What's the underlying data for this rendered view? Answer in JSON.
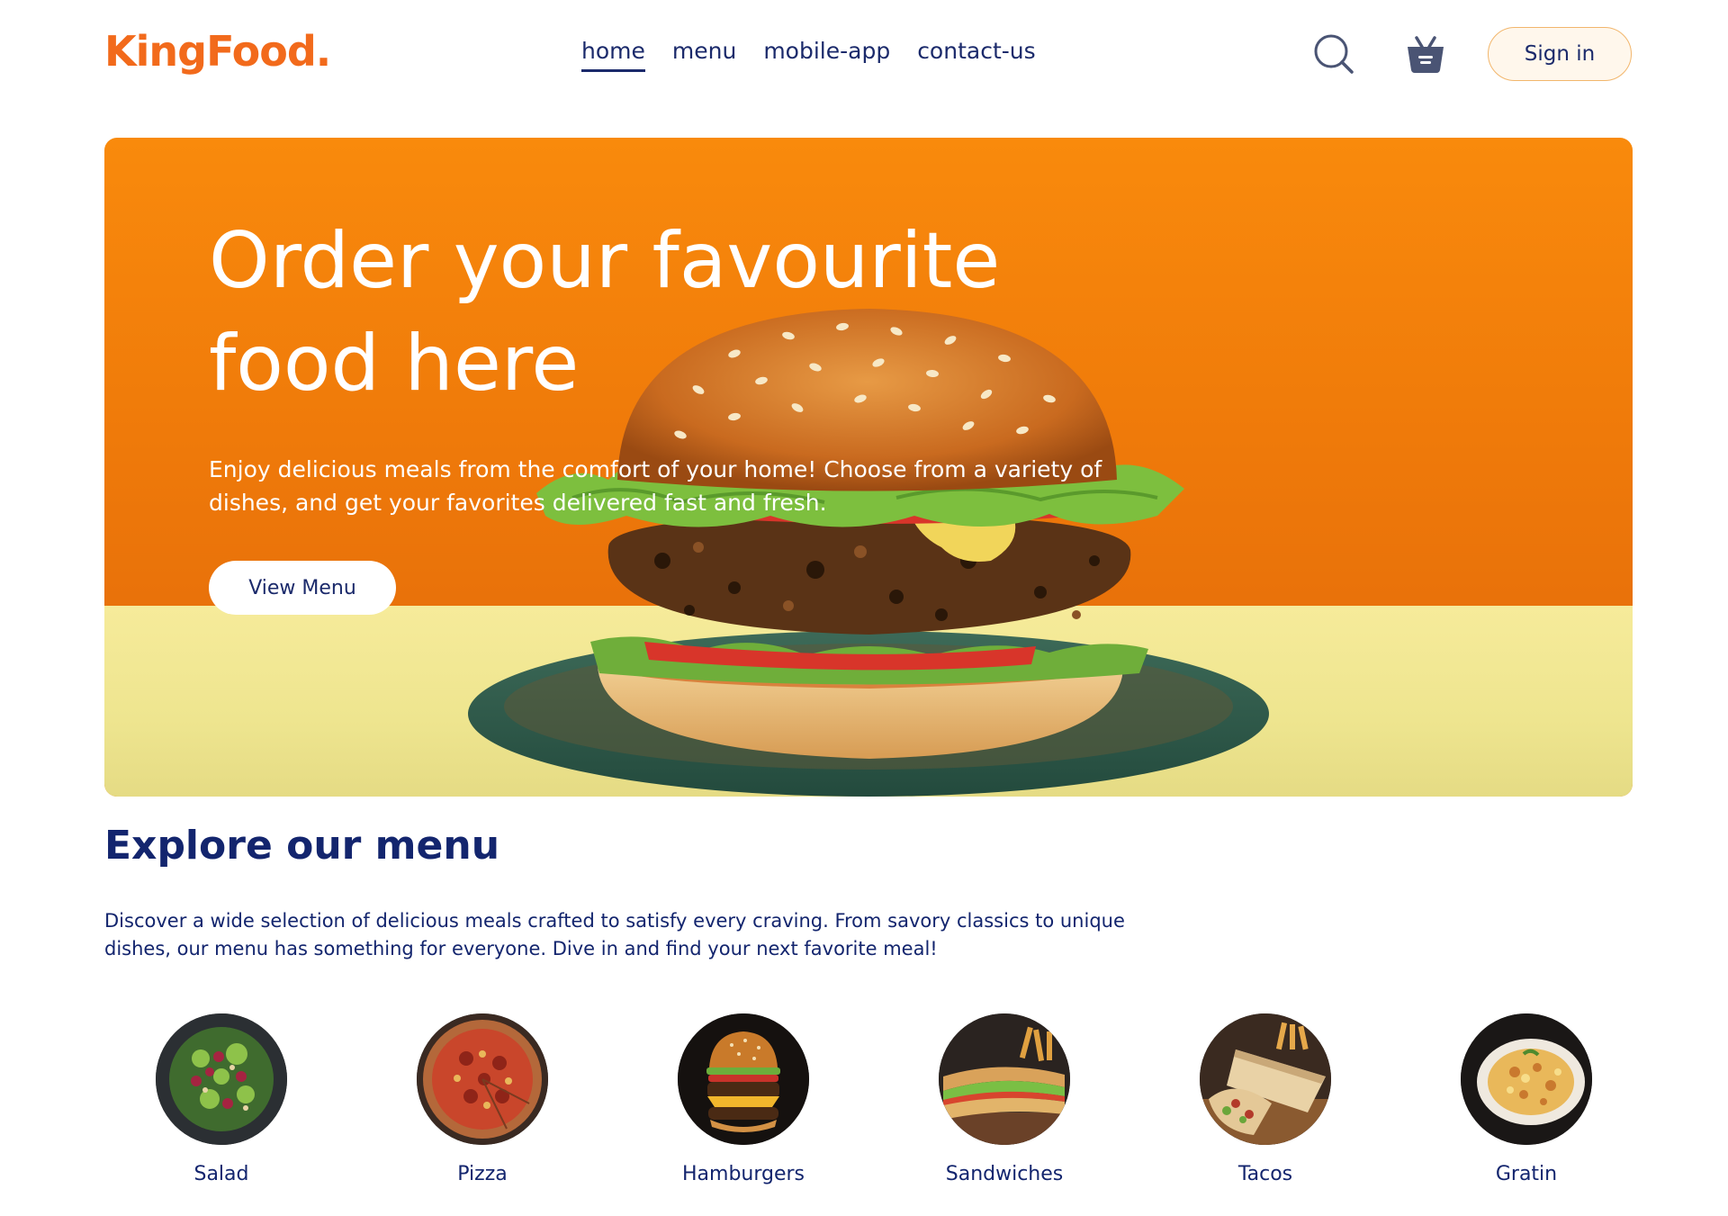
{
  "navbar": {
    "logo": "KingFood.",
    "links": [
      {
        "label": "home",
        "active": true
      },
      {
        "label": "menu",
        "active": false
      },
      {
        "label": "mobile-app",
        "active": false
      },
      {
        "label": "contact-us",
        "active": false
      }
    ],
    "icons": [
      "search-icon",
      "basket-icon"
    ],
    "signin_label": "Sign in"
  },
  "hero": {
    "title_line1": "Order your favourite",
    "title_line2": "food here",
    "text_line1": "Enjoy delicious meals from the comfort of your home! Choose from a variety of",
    "text_line2": "dishes, and get your favorites delivered fast and fresh.",
    "button_label": "View Menu"
  },
  "explore": {
    "title": "Explore our menu",
    "text_line1": "Discover a wide selection of delicious meals crafted to satisfy every craving. From savory classics to unique",
    "text_line2": "dishes, our menu has something for everyone. Dive in and find your next favorite meal!",
    "items": [
      {
        "label": "Salad"
      },
      {
        "label": "Pizza"
      },
      {
        "label": "Hamburgers"
      },
      {
        "label": "Sandwiches"
      },
      {
        "label": "Tacos"
      },
      {
        "label": "Gratin"
      }
    ]
  },
  "colors": {
    "brand": "#f26a1b",
    "navy": "#1b2a6b",
    "hero_orange": "#f98a0c"
  }
}
